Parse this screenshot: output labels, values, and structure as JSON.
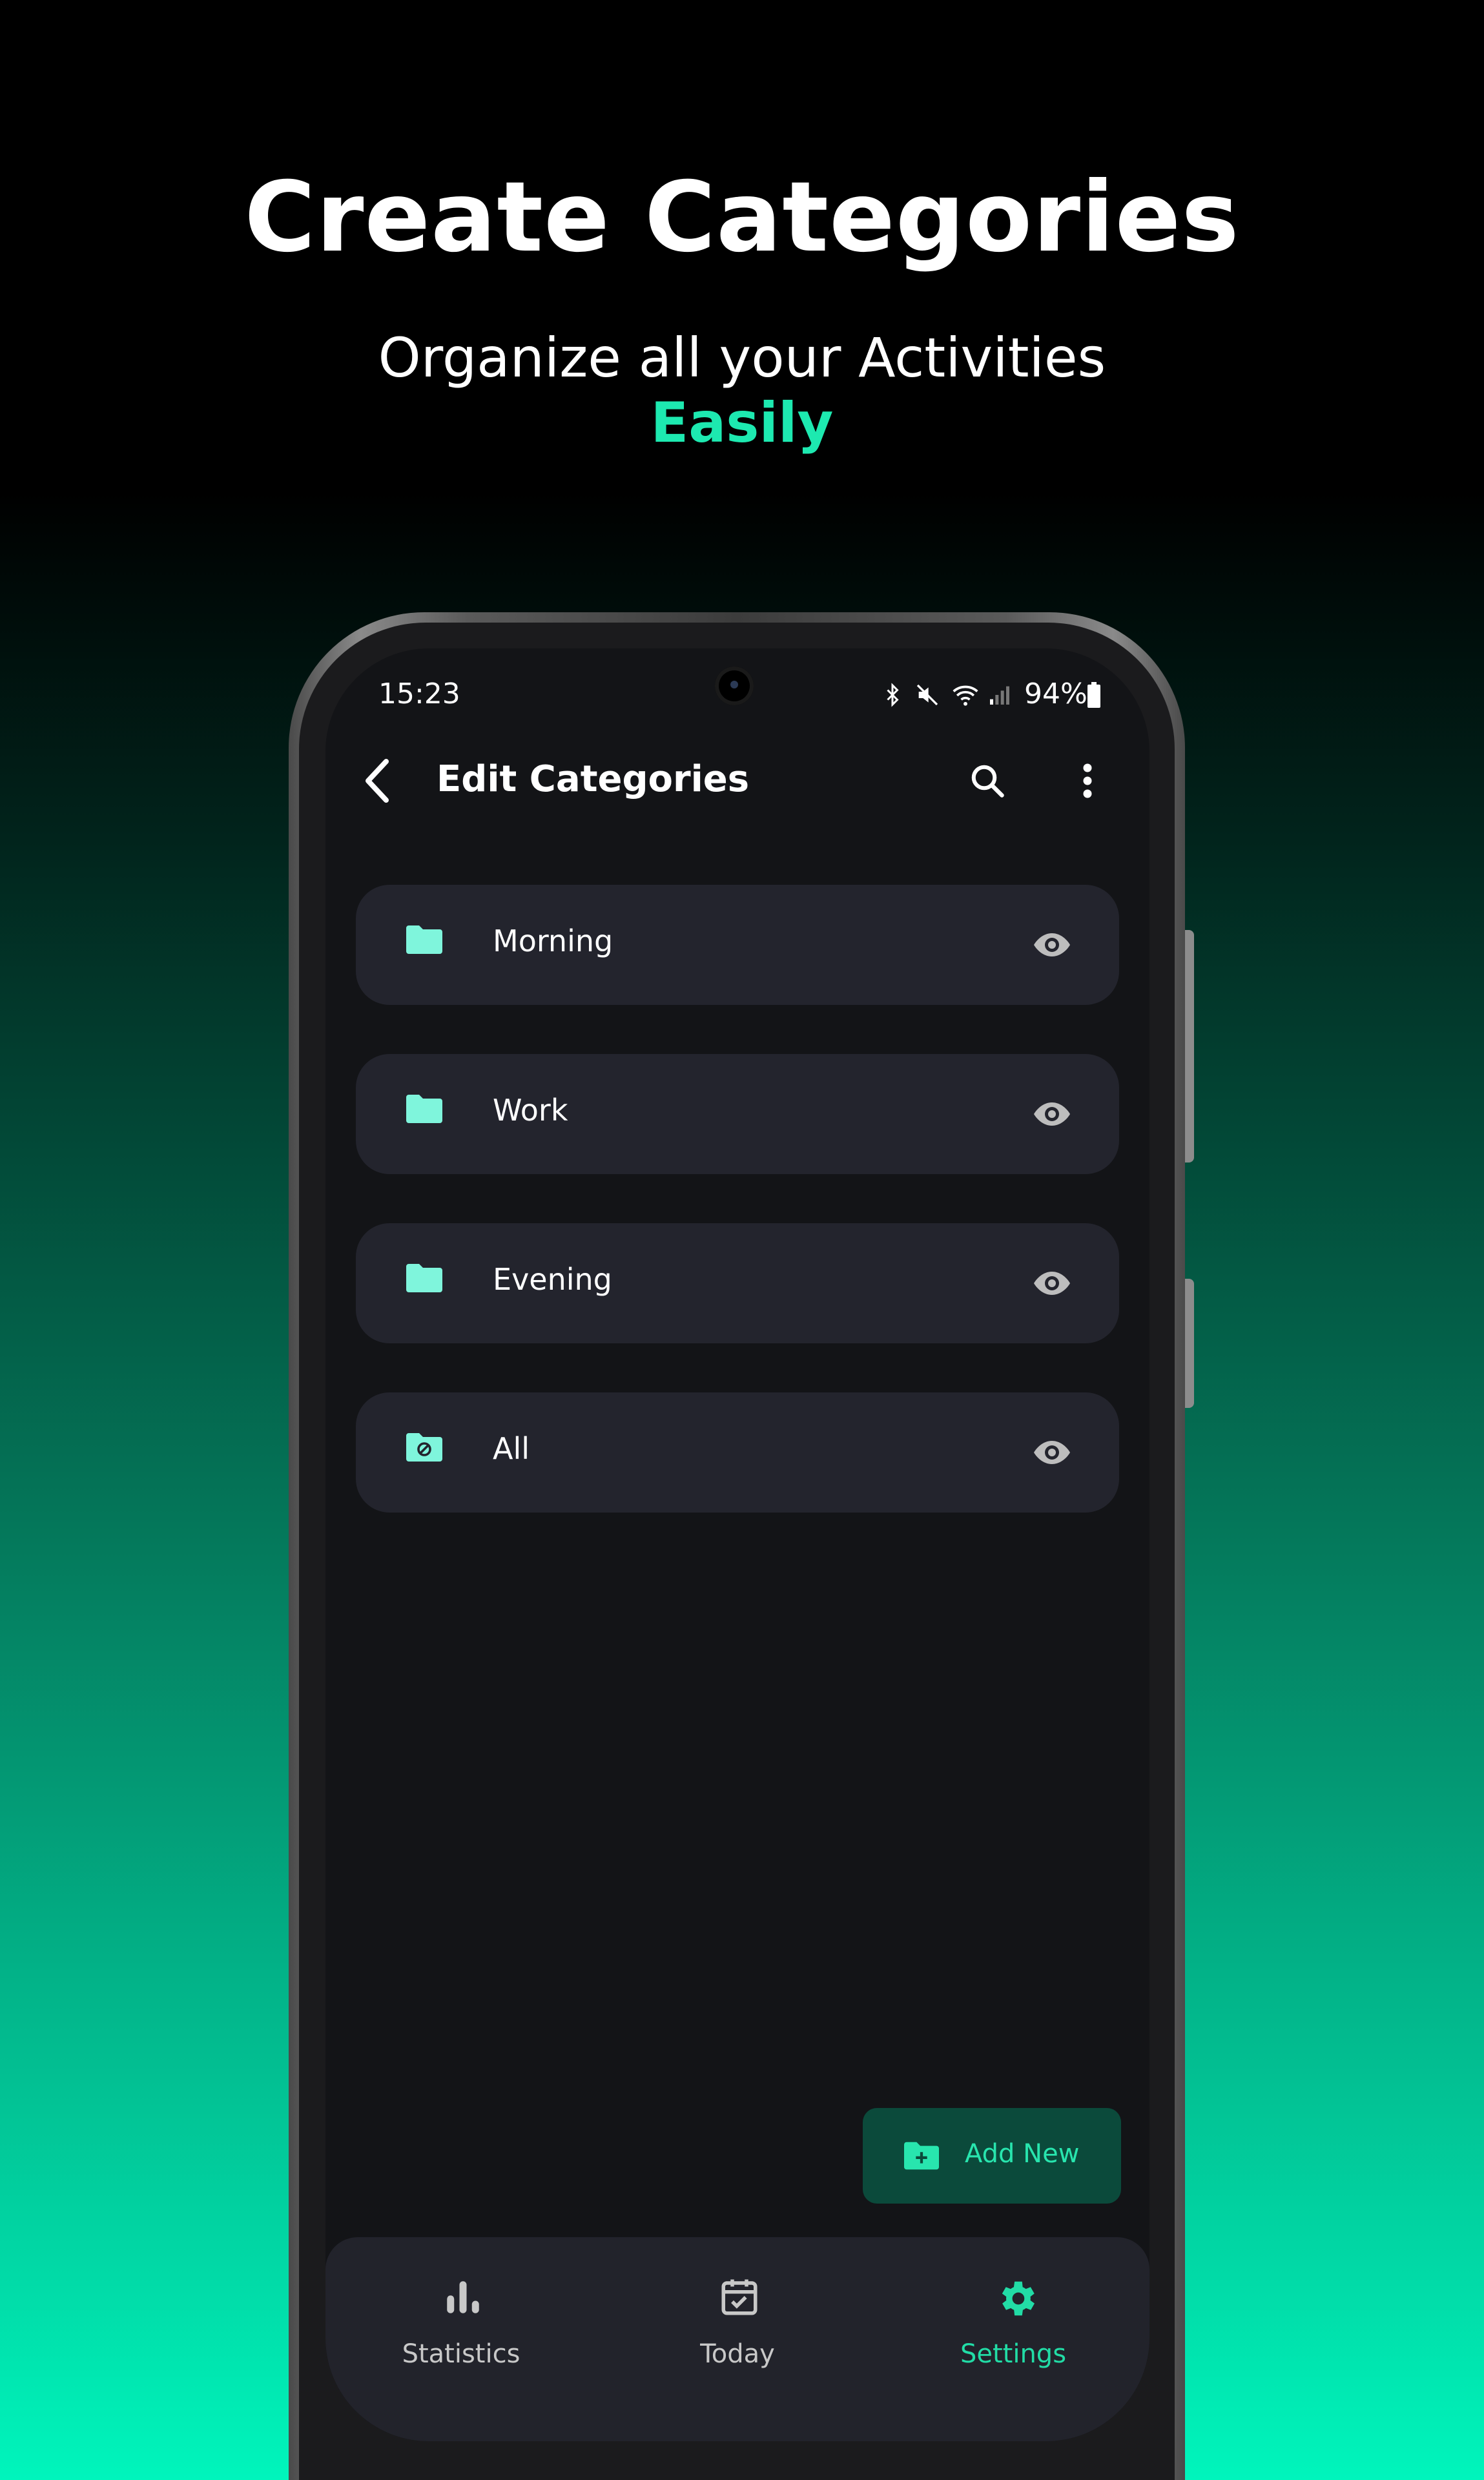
{
  "promo": {
    "headline": "Create Categories",
    "subline": "Organize all your Activities",
    "emphasis": "Easily"
  },
  "status_bar": {
    "time": "15:23",
    "battery": "94%"
  },
  "app_bar": {
    "title": "Edit Categories",
    "back_icon": "chevron-left-icon",
    "search_icon": "search-icon",
    "menu_icon": "more-vert-icon"
  },
  "categories": [
    {
      "label": "Morning",
      "icon": "folder-icon",
      "visibility_icon": "eye-icon"
    },
    {
      "label": "Work",
      "icon": "folder-icon",
      "visibility_icon": "eye-icon"
    },
    {
      "label": "Evening",
      "icon": "folder-icon",
      "visibility_icon": "eye-icon"
    },
    {
      "label": "All",
      "icon": "folder-special-icon",
      "visibility_icon": "eye-icon"
    }
  ],
  "fab": {
    "label": "Add New",
    "icon": "folder-add-icon"
  },
  "bottom_nav": {
    "items": [
      {
        "label": "Statistics",
        "icon": "bar-chart-icon",
        "active": false
      },
      {
        "label": "Today",
        "icon": "calendar-check-icon",
        "active": false
      },
      {
        "label": "Settings",
        "icon": "gear-icon",
        "active": true
      }
    ]
  },
  "colors": {
    "accent": "#1de9b0",
    "folder": "#7ff5dc",
    "card": "#23242d",
    "screen_bg": "#131417",
    "inactive_nav": "#c8c8c8",
    "active_nav": "#22dca6"
  }
}
